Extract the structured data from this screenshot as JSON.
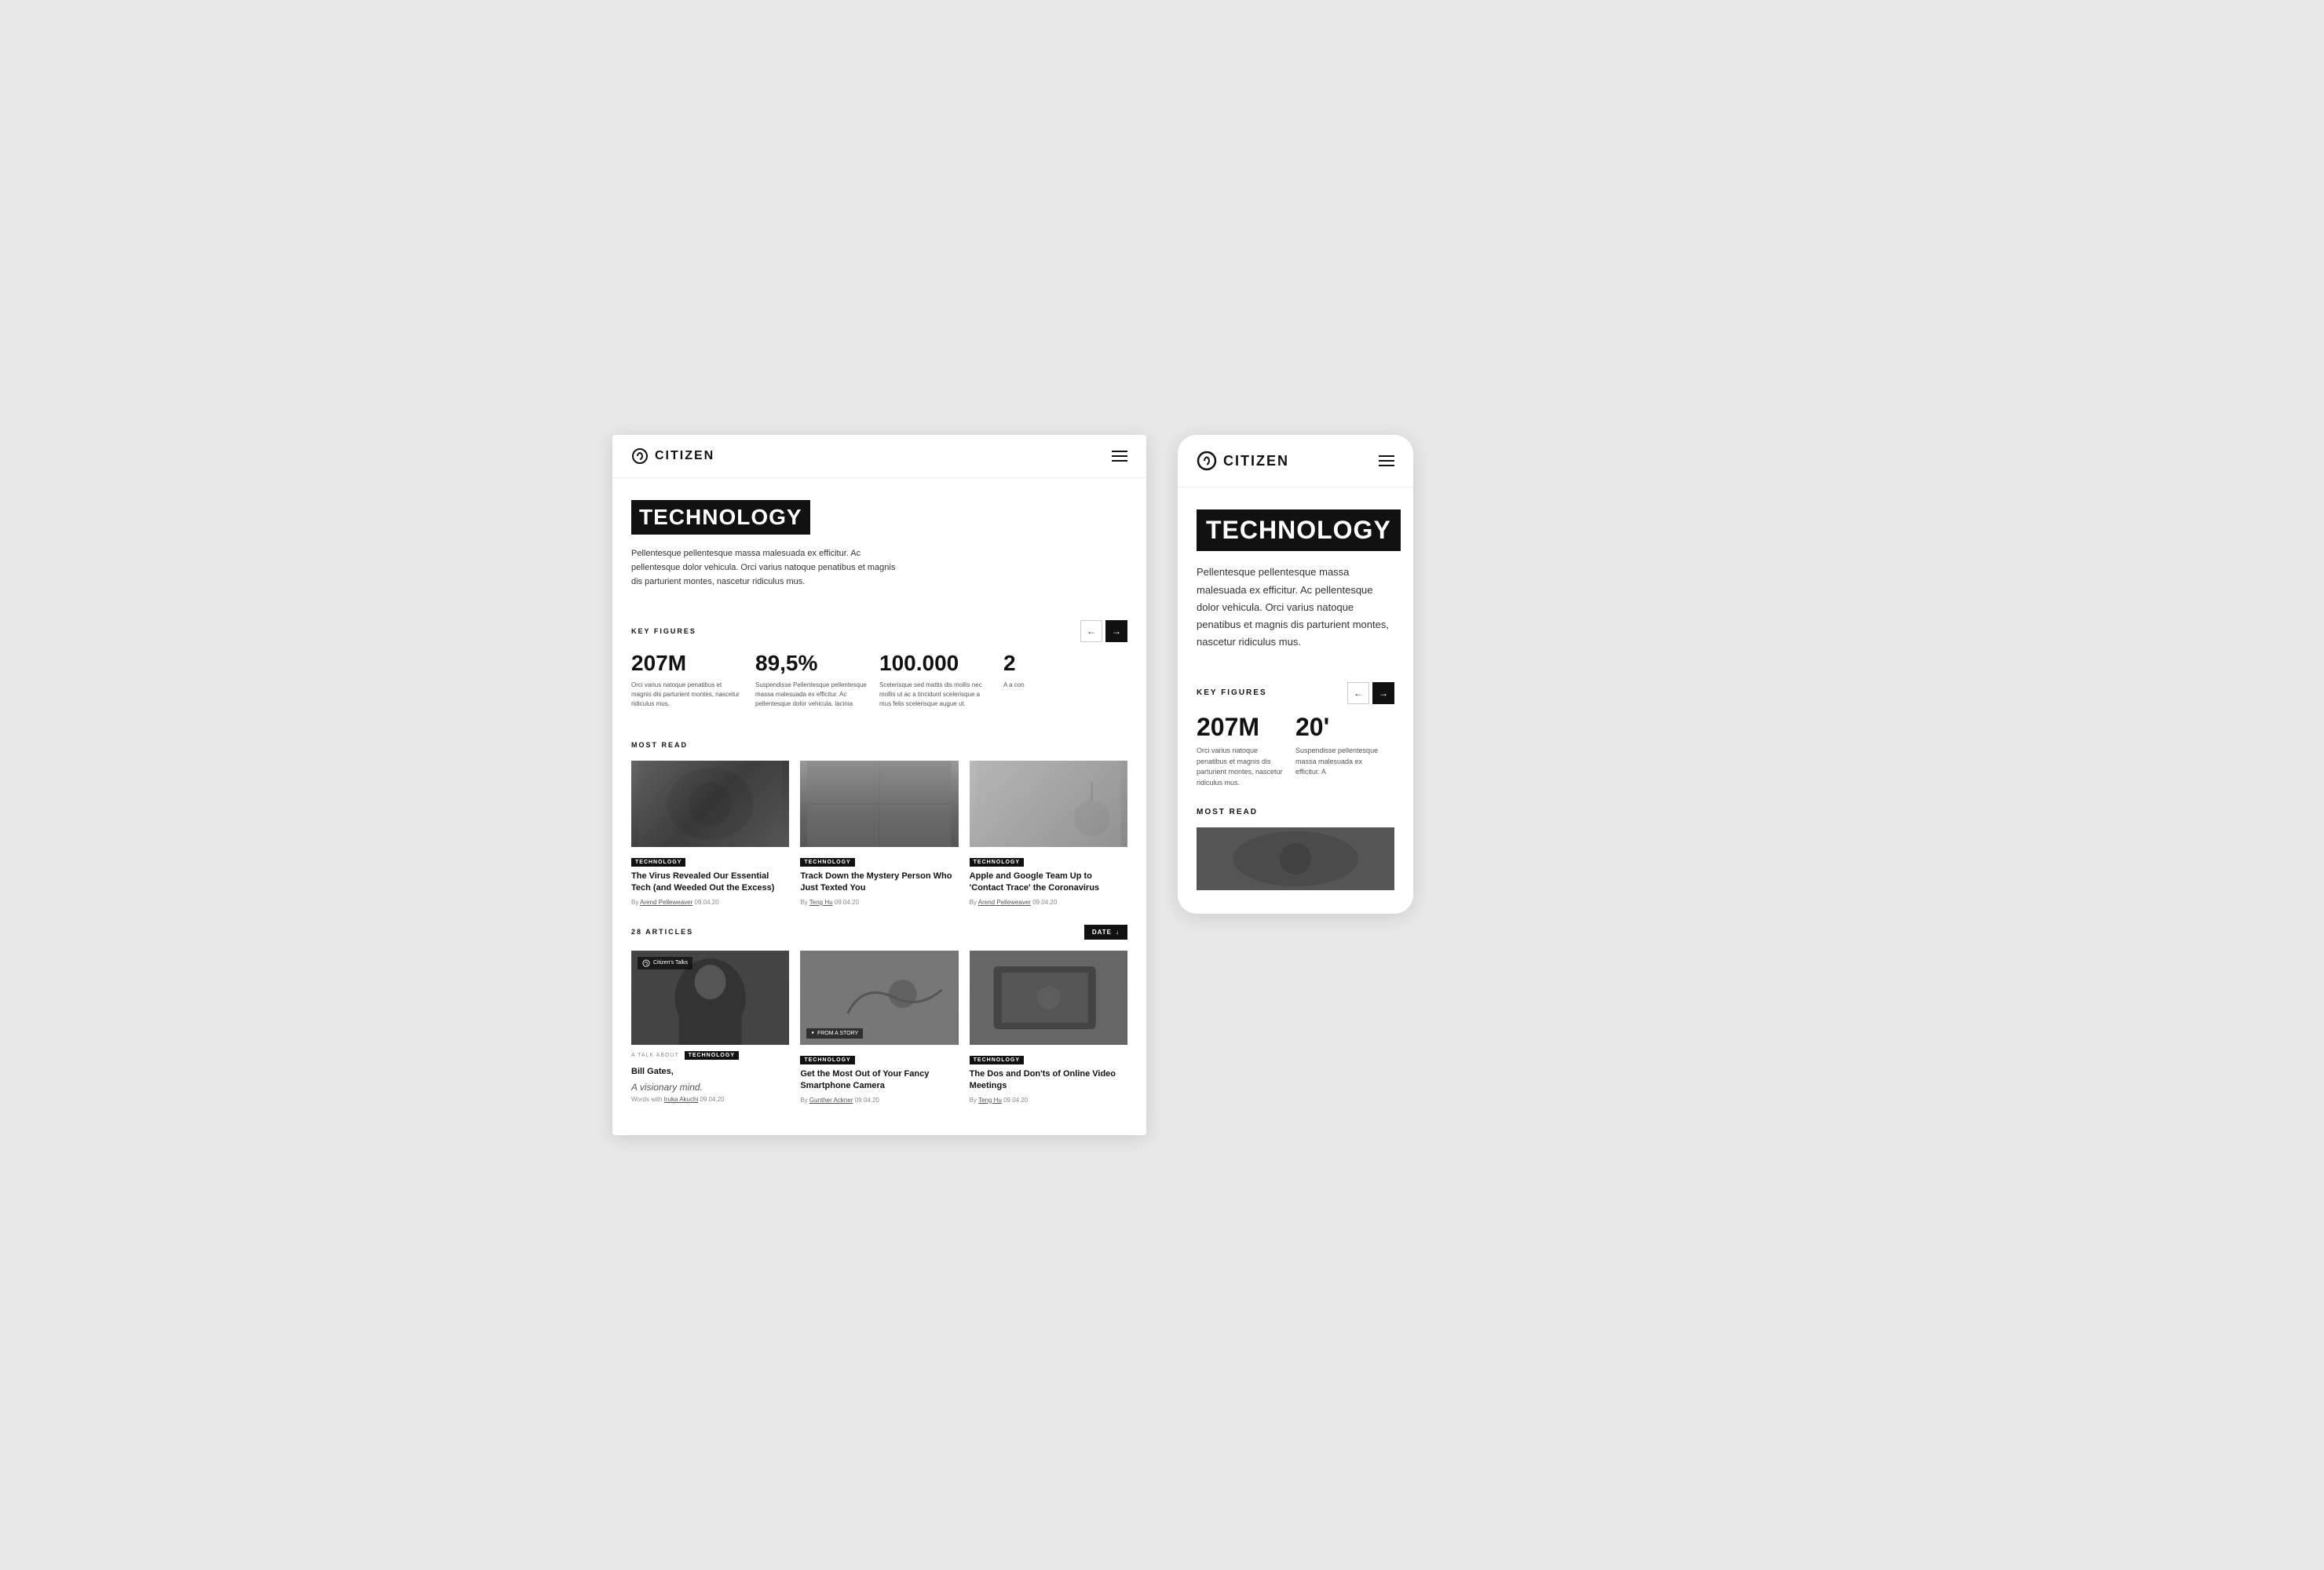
{
  "brand": {
    "name": "CITIZEN",
    "logoAlt": "Citizen Logo"
  },
  "desktop": {
    "header": {
      "logoText": "CITIZEN",
      "menuIcon": "hamburger"
    },
    "hero": {
      "categoryTitle": "TECHNOLOGY",
      "description": "Pellentesque pellentesque massa malesuada ex efficitur. Ac pellentesque dolor vehicula. Orci varius natoque penatibus et magnis dis parturient montes, nascetur ridiculus mus."
    },
    "keyFigures": {
      "label": "KEY FIGURES",
      "prevArrowLabel": "←",
      "nextArrowLabel": "→",
      "items": [
        {
          "number": "207M",
          "description": "Orci varius natoque penatibus et magnis dis parturient montes, nascetur ridiculus mus."
        },
        {
          "number": "89,5%",
          "description": "Suspendisse Pellentesque pellentesque massa malesuada ex efficitur. Ac pellentesque dolor vehicula.  lacinia"
        },
        {
          "number": "100.000",
          "description": "Scelerisque sed mattis dis mollis nec mollis ut ac a tincidunt scelerisque a mus felis scelerisque augue ut."
        },
        {
          "number": "2",
          "description": "A a con"
        }
      ]
    },
    "mostRead": {
      "label": "MOST READ",
      "cards": [
        {
          "tag": "TECHNOLOGY",
          "title": "The Virus Revealed Our Essential Tech (and Weeded Out the Excess)",
          "author": "Arend Pelleweaver",
          "date": "09.04.20"
        },
        {
          "tag": "TECHNOLOGY",
          "title": "Track Down the Mystery Person Who Just Texted You",
          "author": "Teng Hu",
          "date": "09.04.20"
        },
        {
          "tag": "TECHNOLOGY",
          "title": "Apple and Google Team Up to 'Contact Trace' the Coronavirus",
          "author": "Arend Pelleweaver",
          "date": "09.04.20"
        }
      ]
    },
    "articles": {
      "count": "28 ARTICLES",
      "filterLabel": "DATE",
      "filterIcon": "↓",
      "items": [
        {
          "overlayBadge": "Citizen's Talks",
          "preLabel": "A TALK ABOUT",
          "tag": "TECHNOLOGY",
          "title": "Bill Gates,",
          "subtitle": "A visionary mind.",
          "metaPrefix": "Words with",
          "author": "Iruka Akuchi",
          "date": "09.04.20"
        },
        {
          "fromStoryBadge": "FROM A STORY",
          "tag": "TECHNOLOGY",
          "title": "Get the Most Out of Your Fancy Smartphone Camera",
          "author": "Gunther Ackner",
          "date": "09.04.20"
        },
        {
          "tag": "TECHNOLOGY",
          "title": "The Dos and Don'ts of Online Video Meetings",
          "author": "Teng Hu",
          "date": "09.04.20"
        }
      ]
    }
  },
  "mobile": {
    "header": {
      "logoText": "CITIZEN"
    },
    "hero": {
      "categoryTitle": "TECHNOLOGY",
      "description": "Pellentesque pellentesque massa malesuada ex efficitur. Ac pellentesque dolor vehicula. Orci varius natoque penatibus et magnis dis parturient montes, nascetur ridiculus mus."
    },
    "keyFigures": {
      "label": "KEY FIGURES",
      "items": [
        {
          "number": "207M",
          "description": "Orci varius natoque penatibus et magnis dis parturient montes, nascetur ridiculus mus."
        },
        {
          "number": "20'",
          "description": "Suspendisse pellentesque massa malesuada ex efficitur. A"
        }
      ]
    },
    "mostRead": {
      "label": "MOST READ"
    }
  }
}
